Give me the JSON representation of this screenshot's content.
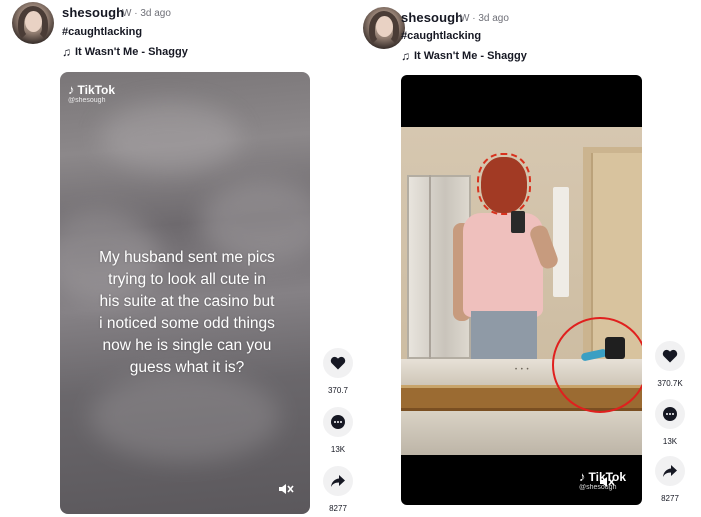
{
  "left_post": {
    "username": "shesough",
    "meta": "W · 3d ago",
    "hashtag": "#caughtlacking",
    "music_icon": "music-note-icon",
    "music": "It Wasn't Me - Shaggy",
    "video": {
      "watermark_brand": "TikTok",
      "watermark_handle": "@shesough",
      "caption": "My husband sent me pics\ntrying to look all cute in\nhis suite at the casino but\ni noticed some odd things\nnow he is single can you\nguess what it is?",
      "mute_icon": "mute-icon"
    },
    "actions": {
      "like_count": "370.7",
      "comment_count": "13K",
      "share_count": "8277"
    }
  },
  "right_post": {
    "username": "shesough",
    "meta": "W · 3d ago",
    "hashtag": "#caughtlacking",
    "music_icon": "music-note-icon",
    "music": "It Wasn't Me - Shaggy",
    "video": {
      "watermark_brand": "TikTok",
      "watermark_handle": "@shesough",
      "mute_icon": "mute-icon",
      "annotation_color": "#e0201e"
    },
    "actions": {
      "like_count": "370.7K",
      "comment_count": "13K",
      "share_count": "8277"
    }
  }
}
